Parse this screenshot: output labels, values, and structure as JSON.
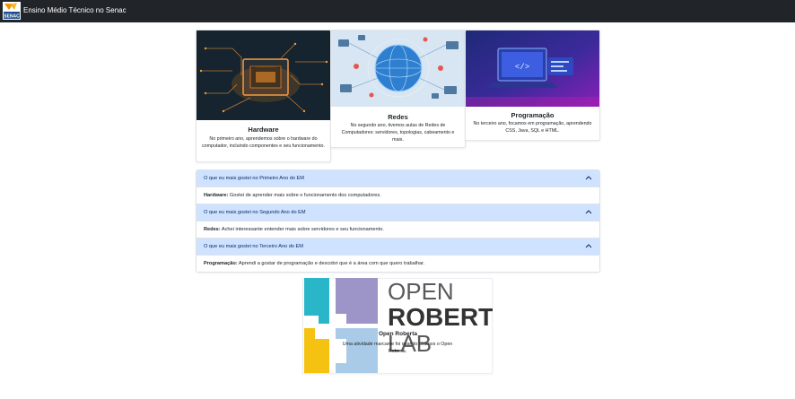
{
  "navbar": {
    "brand": "Ensino Médio Técnico no Senac",
    "logo_text": "SENAC"
  },
  "cards": [
    {
      "title": "Hardware",
      "text": "No primeiro ano, aprendemos sobre o hardware do computador, incluindo componentes e seu funcionamento.",
      "image": "circuit-board-image"
    },
    {
      "title": "Redes",
      "text": "No segundo ano, tivemos aulas de Redes de Computadores: servidores, topologias, cabeamento e mais.",
      "image": "network-globe-image"
    },
    {
      "title": "Programação",
      "text": "No terceiro ano, focamos em programação, aprendendo CSS, Java, SQL e HTML.",
      "image": "laptop-code-image"
    }
  ],
  "accordion": [
    {
      "header": "O que eu mais gostei no Primeiro Ano do EM",
      "body_strong": "Hardware:",
      "body_text": " Gostei de aprender mais sobre o funcionamento dos computadores."
    },
    {
      "header": "O que eu mais gostei no Segundo Ano do EM",
      "body_strong": "Redes:",
      "body_text": " Achei interessante entender mais sobre servidores e seu funcionamento."
    },
    {
      "header": "O que eu mais gostei no Terceiro Ano do EM",
      "body_strong": "Programação:",
      "body_text": " Aprendi a gostar de programação e descobri que é a área com que quero trabalhar."
    }
  ],
  "open_roberta": {
    "logo_line1": "OPEN",
    "logo_line2": "ROBERT",
    "logo_line3": "LAB",
    "title": "Open Roberta",
    "text": "Uma atividade marcante foi quando usamos o Open Roberta."
  },
  "colors": {
    "navbar": "#212529",
    "accordion_header": "#cfe2ff",
    "accordion_header_text": "#052c65",
    "robot_cyan": "#29b6c9",
    "robot_purple": "#9d95c7",
    "robot_yellow": "#f5c211",
    "robot_lightblue": "#a9cbe8"
  }
}
